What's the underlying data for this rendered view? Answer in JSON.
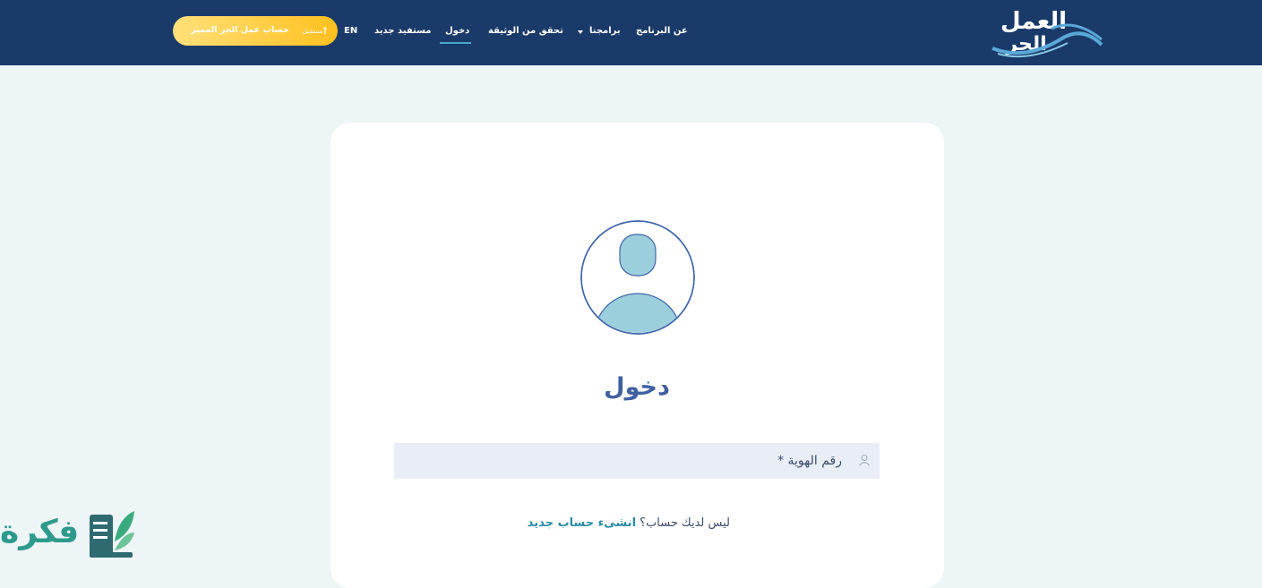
{
  "header": {
    "logo_alt": "العمل الحر",
    "nav": {
      "about": "عن البرنامج",
      "programs": "برامجنا",
      "verify": "تحقق من الوثيقة",
      "login": "دخول",
      "new_beneficiary": "مستفيد جديد",
      "lang": "EN"
    },
    "premium_button": "حساب عمل الحر المميز",
    "premium_icon_text": "مستقبل"
  },
  "login": {
    "title": "دخول",
    "id_placeholder": "رقم الهوية *",
    "id_value": "",
    "no_account_text": "ليس لديك حساب؟",
    "create_account_link": "انشىء حساب جديد"
  },
  "watermark": {
    "text": "فكرة"
  },
  "colors": {
    "header_bg": "#1a3a69",
    "page_bg": "#eef5f7",
    "title": "#3f60a0",
    "link": "#2a8aa5",
    "premium_start": "#ffe07a",
    "premium_end": "#ffc01f"
  }
}
